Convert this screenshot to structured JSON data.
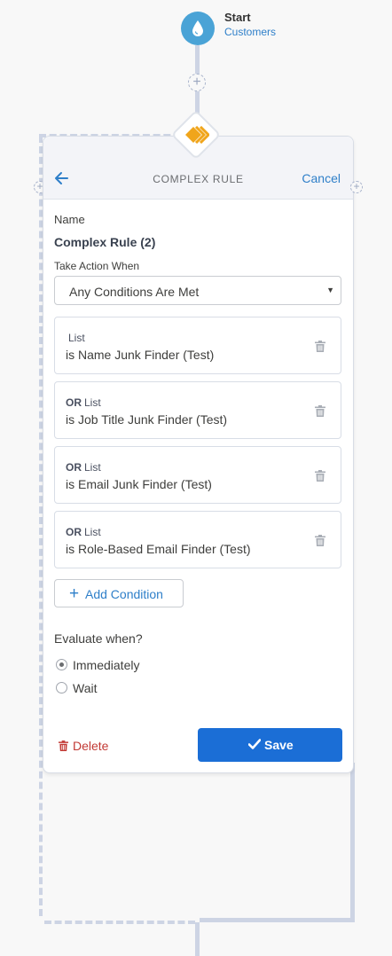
{
  "start": {
    "title": "Start",
    "subtitle": "Customers"
  },
  "panel": {
    "title": "COMPLEX RULE",
    "cancel_label": "Cancel",
    "name_label": "Name",
    "name_value": "Complex Rule (2)",
    "take_action_label": "Take Action When",
    "take_action_value": "Any Conditions Are Met",
    "conditions": [
      {
        "prefix": "",
        "type": "List",
        "text": "is Name Junk Finder (Test)"
      },
      {
        "prefix": "OR",
        "type": "List",
        "text": "is Job Title Junk Finder (Test)"
      },
      {
        "prefix": "OR",
        "type": "List",
        "text": "is Email Junk Finder (Test)"
      },
      {
        "prefix": "OR",
        "type": "List",
        "text": "is Role-Based Email Finder (Test)"
      }
    ],
    "add_condition_label": "Add Condition",
    "evaluate_label": "Evaluate when?",
    "evaluate_options": [
      {
        "label": "Immediately",
        "checked": true
      },
      {
        "label": "Wait",
        "checked": false
      }
    ],
    "delete_label": "Delete",
    "save_label": "Save"
  },
  "icons": {
    "start": "water-drop-icon",
    "rule": "chevrons-right-icon",
    "back": "arrow-left-icon",
    "trash": "trash-icon",
    "add": "plus-icon",
    "save": "checkmark-icon"
  },
  "colors": {
    "accent": "#2e7fc9",
    "save_button": "#1b6ed6",
    "delete": "#c23934",
    "start_node": "#4aa3d6",
    "rule_icon": "#f0a51b",
    "connector": "#cdd4e4"
  }
}
